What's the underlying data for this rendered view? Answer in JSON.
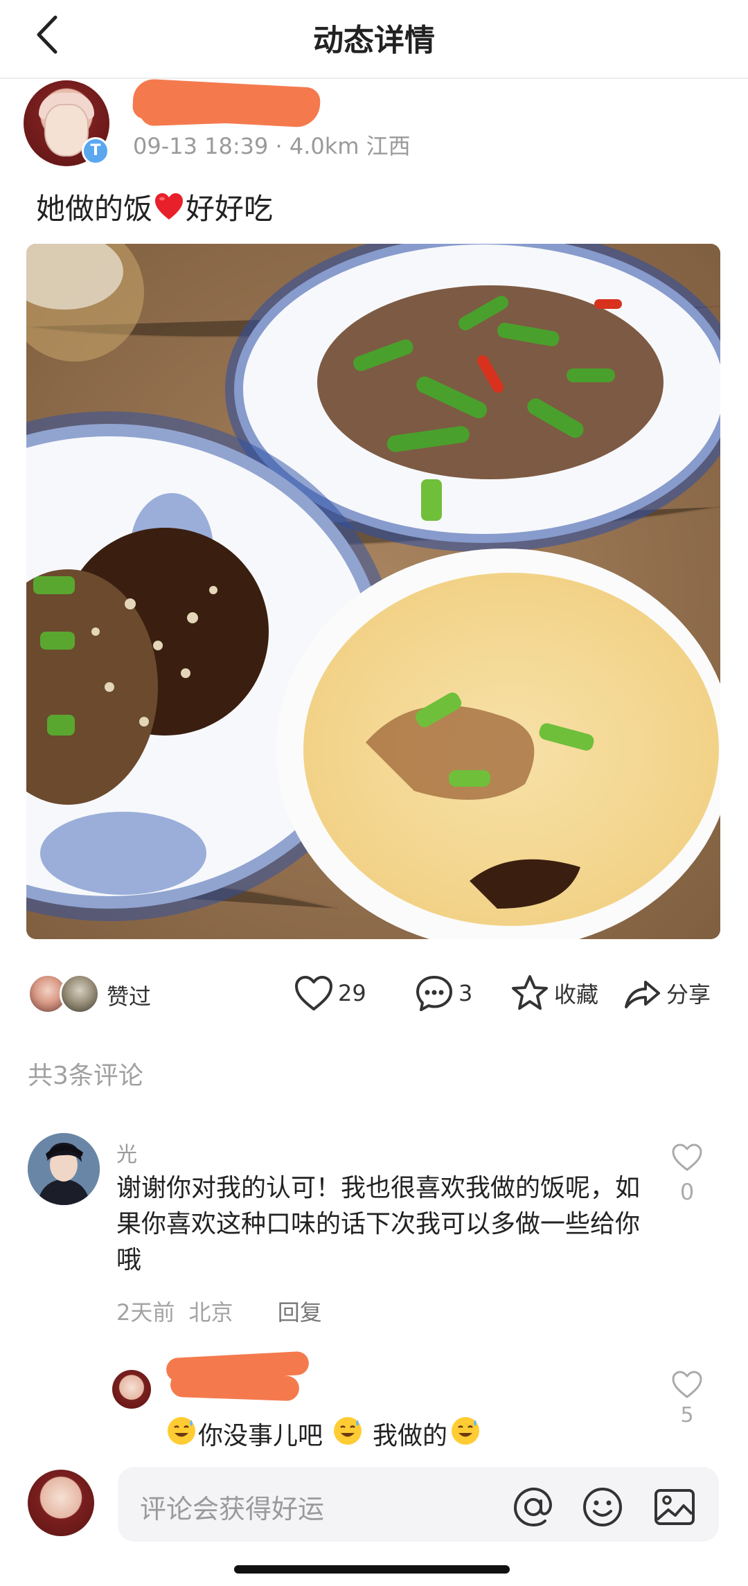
{
  "header": {
    "title": "动态详情"
  },
  "post": {
    "vip_badge": "T",
    "meta": "09-13 18:39 · 4.0km 江西",
    "text_before": "她做的饭",
    "text_after": "好好吃",
    "emoji": "red-heart"
  },
  "actions": {
    "likers_label": "赞过",
    "like_count": "29",
    "comment_count": "3",
    "favorite_label": "收藏",
    "share_label": "分享"
  },
  "comments": {
    "count_label": "共3条评论",
    "items": [
      {
        "name": "光",
        "text": "谢谢你对我的认可！我也很喜欢我做的饭呢，如果你喜欢这种口味的话下次我可以多做一些给你哦",
        "time": "2天前",
        "location": "北京",
        "reply_label": "回复",
        "likes": "0"
      }
    ],
    "reply": {
      "text_part1": "你没事儿吧",
      "text_part2": "我做的",
      "likes": "5"
    }
  },
  "bottom_bar": {
    "placeholder": "评论会获得好运"
  },
  "colors": {
    "redaction": "#f47a4e",
    "muted_text": "#9a9a9a",
    "vip_badge": "#5aa7f0",
    "heart": "#e8202a"
  }
}
